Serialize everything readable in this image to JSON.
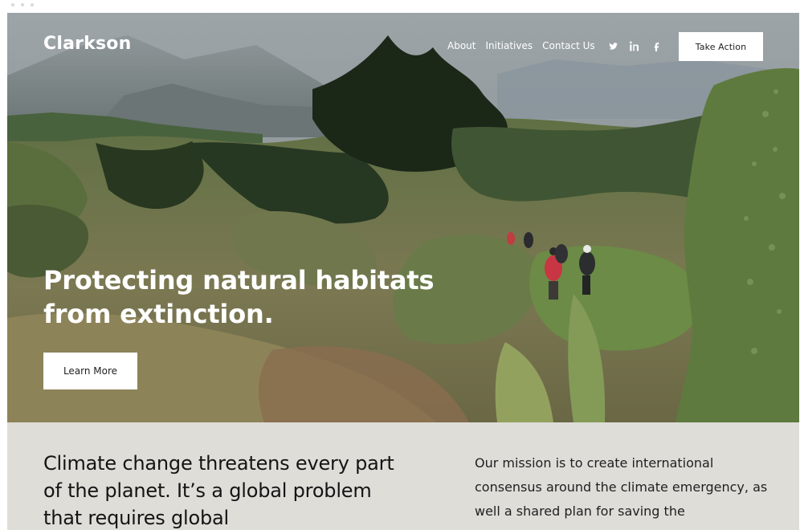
{
  "site": {
    "brand": "Clarkson"
  },
  "nav": {
    "items": [
      {
        "label": "About"
      },
      {
        "label": "Initiatives"
      },
      {
        "label": "Contact Us"
      }
    ],
    "social": [
      {
        "icon": "twitter-icon"
      },
      {
        "icon": "linkedin-icon"
      },
      {
        "icon": "facebook-icon"
      }
    ],
    "cta_label": "Take Action"
  },
  "hero": {
    "title": "Protecting natural habitats from extinction.",
    "button_label": "Learn More"
  },
  "intro": {
    "headline": "Climate change threatens every part of the planet. It’s a global problem that requires global",
    "mission": "Our mission is to create international consensus around the climate emergency, as well a shared plan for saving the"
  },
  "colors": {
    "white": "#ffffff",
    "panel": "#deddd8",
    "text_dark": "#141414"
  }
}
